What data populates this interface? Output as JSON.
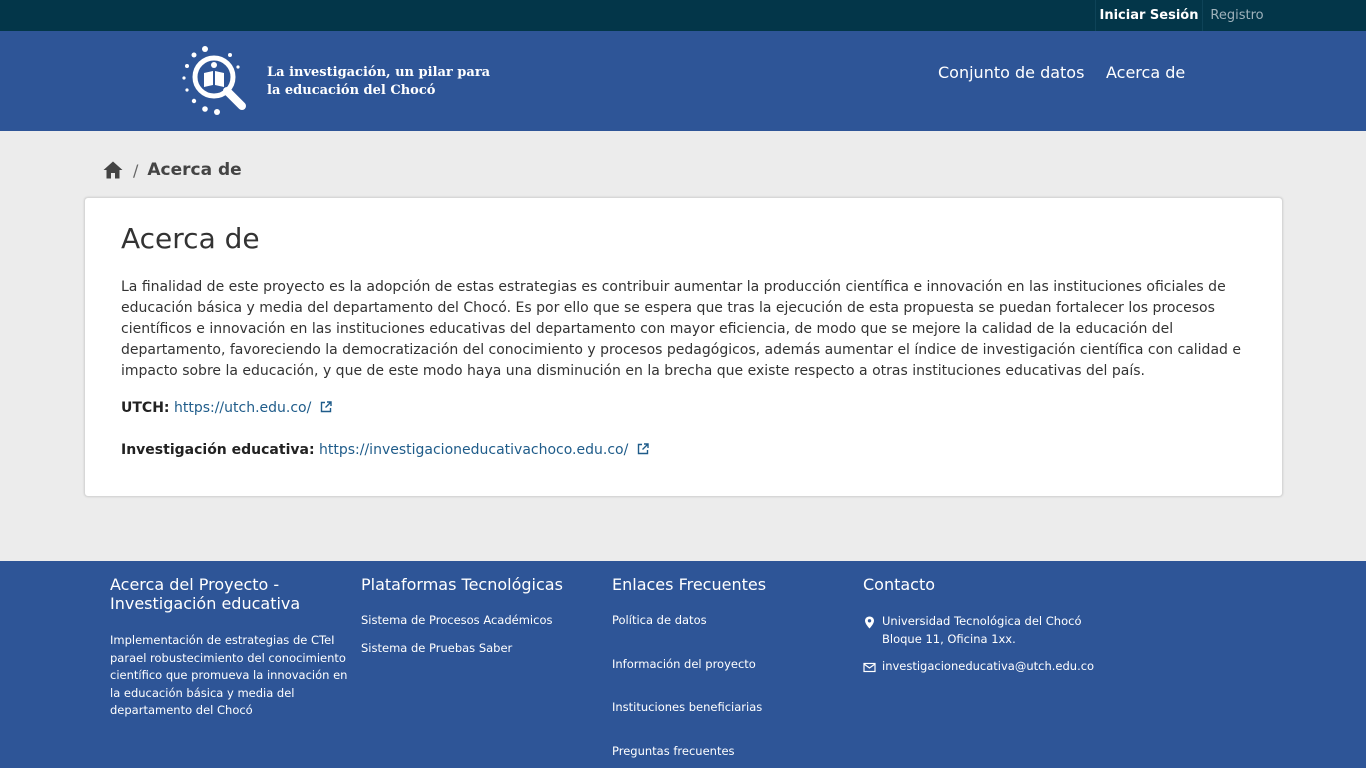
{
  "account": {
    "login_label": "Iniciar Sesión",
    "register_label": "Registro"
  },
  "header": {
    "tagline_line1": "La investigación, un pilar para",
    "tagline_line2": "la educación del Chocó",
    "nav": {
      "datasets": "Conjunto de datos",
      "about": "Acerca de"
    }
  },
  "breadcrumb": {
    "separator": "/",
    "current": "Acerca de"
  },
  "main": {
    "title": "Acerca de",
    "body": "La finalidad de este proyecto es la adopción de estas estrategias es contribuir aumentar la producción científica e innovación en las instituciones oficiales de educación básica y media del departamento del Chocó. Es por ello que se espera que tras la ejecución de esta propuesta se puedan fortalecer los procesos científicos e innovación en las instituciones educativas del departamento con mayor eficiencia, de modo que se mejore la calidad de la educación del departamento, favoreciendo la democratización del conocimiento y procesos pedagógicos, además aumentar el índice de investigación científica con calidad e impacto sobre la educación, y que de este modo haya una disminución en la brecha que existe respecto a otras instituciones educativas del país.",
    "links": [
      {
        "label": "UTCH:",
        "url": "https://utch.edu.co/"
      },
      {
        "label": "Investigación educativa:",
        "url": "https://investigacioneducativachoco.edu.co/"
      }
    ]
  },
  "footer": {
    "about": {
      "title": "Acerca del Proyecto - Investigación educativa",
      "description": "Implementación de estrategias de CTeI parael robustecimiento del conocimiento científico que promueva la innovación en la educación básica y media del departamento del Chocó"
    },
    "platforms": {
      "title": "Plataformas Tecnológicas",
      "items": [
        "Sistema de Procesos Académicos",
        "Sistema de Pruebas Saber"
      ]
    },
    "frequent_links": {
      "title": "Enlaces Frecuentes",
      "items": [
        "Política de datos",
        "Información del proyecto",
        "Instituciones beneficiarias",
        "Preguntas frecuentes"
      ]
    },
    "contact": {
      "title": "Contacto",
      "address_line1": "Universidad Tecnológica del Chocó",
      "address_line2": "Bloque 11, Oficina 1xx.",
      "email": "investigacioneducativa@utch.edu.co"
    }
  },
  "colors": {
    "brand_blue": "#2e5597",
    "account_bar": "#033649",
    "link": "#1f5c8a",
    "page_background": "#ececec"
  },
  "icons": [
    "logo-magnifier-book-icon",
    "home-icon",
    "external-link-icon",
    "location-pin-icon",
    "mail-icon"
  ]
}
